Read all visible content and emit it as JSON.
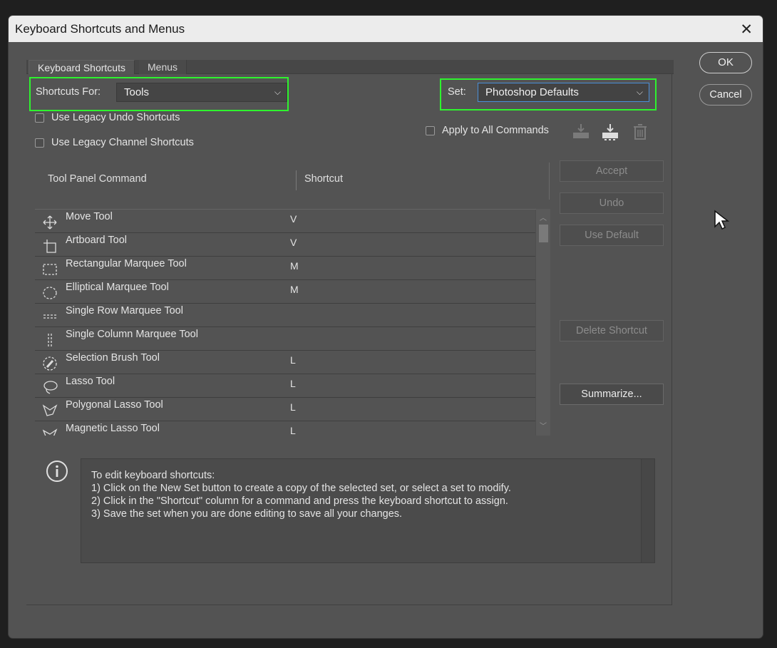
{
  "window": {
    "title": "Keyboard Shortcuts and Menus"
  },
  "tabs": [
    {
      "label": "Keyboard Shortcuts"
    },
    {
      "label": "Menus"
    }
  ],
  "shortcuts_for": {
    "label": "Shortcuts For:",
    "value": "Tools"
  },
  "set": {
    "label": "Set:",
    "value": "Photoshop Defaults"
  },
  "options": {
    "legacy_undo": "Use Legacy Undo Shortcuts",
    "legacy_channel": "Use Legacy Channel Shortcuts",
    "apply_all": "Apply to All Commands"
  },
  "buttons": {
    "ok": "OK",
    "cancel": "Cancel",
    "accept": "Accept",
    "undo": "Undo",
    "use_default": "Use Default",
    "delete_shortcut": "Delete Shortcut",
    "summarize": "Summarize..."
  },
  "table": {
    "columns": [
      "Tool Panel Command",
      "Shortcut"
    ],
    "rows": [
      {
        "name": "Move Tool",
        "shortcut": "V",
        "icon": "move-icon"
      },
      {
        "name": "Artboard Tool",
        "shortcut": "V",
        "icon": "artboard-icon"
      },
      {
        "name": "Rectangular Marquee Tool",
        "shortcut": "M",
        "icon": "rect-marquee-icon"
      },
      {
        "name": "Elliptical Marquee Tool",
        "shortcut": "M",
        "icon": "ellipse-marquee-icon"
      },
      {
        "name": "Single Row Marquee Tool",
        "shortcut": "",
        "icon": "single-row-marquee-icon"
      },
      {
        "name": "Single Column Marquee Tool",
        "shortcut": "",
        "icon": "single-column-marquee-icon"
      },
      {
        "name": "Selection Brush Tool",
        "shortcut": "L",
        "icon": "selection-brush-icon"
      },
      {
        "name": "Lasso Tool",
        "shortcut": "L",
        "icon": "lasso-icon"
      },
      {
        "name": "Polygonal Lasso Tool",
        "shortcut": "L",
        "icon": "polygonal-lasso-icon"
      },
      {
        "name": "Magnetic Lasso Tool",
        "shortcut": "L",
        "icon": "magnetic-lasso-icon"
      }
    ]
  },
  "info": {
    "lines": [
      "To edit keyboard shortcuts:",
      "1) Click on the New Set button to create a copy of the selected set, or select a set to modify.",
      "2) Click in the \"Shortcut\" column for a command and press the keyboard shortcut to assign.",
      "3) Save the set when you are done editing to save all your changes."
    ]
  }
}
